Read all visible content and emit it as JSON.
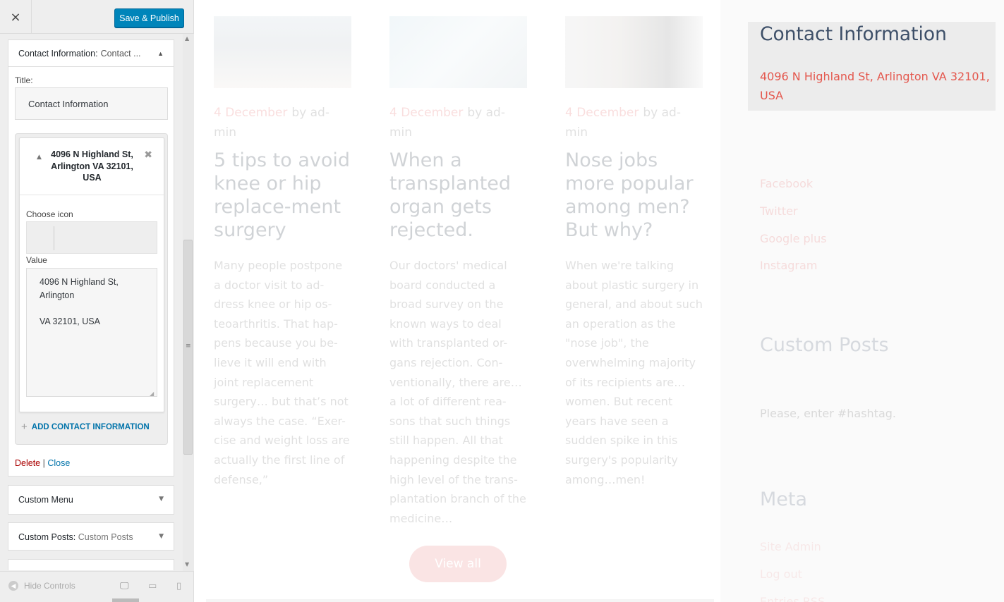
{
  "topbar": {
    "close_icon": "×",
    "publish_label": "Save & Publish"
  },
  "sections": {
    "contact": {
      "title": "Contact Information:",
      "subtitle": "Contact ...",
      "title_label": "Title:",
      "title_value": "Contact Information",
      "item": {
        "title": "4096 N Highland St, Arlington VA 32101, USA",
        "choose_icon_label": "Choose icon",
        "value_label": "Value",
        "value_text": "4096 N Highland St,\nArlington\n\nVA 32101, USA"
      },
      "add_label": "ADD CONTACT INFORMATION",
      "delete_label": "Delete",
      "separator": "|",
      "close_label": "Close"
    },
    "custom_menu": {
      "title": "Custom Menu"
    },
    "custom_posts": {
      "title": "Custom Posts:",
      "subtitle": "Custom Posts"
    }
  },
  "footer": {
    "hide_controls_label": "Hide Controls"
  },
  "preview": {
    "posts": [
      {
        "date": "4 December",
        "byline": "by ad-\nmin",
        "title": "5 tips to avoid knee or hip replace-ment surgery",
        "excerpt": "Many people postpone a doctor visit to ad-dress knee or hip os-teoarthritis. That hap-pens because you be-lieve it will end with joint replacement surgery… but that’s not always the case. “Exer-cise and weight loss are actually the first line of defense,”"
      },
      {
        "date": "4 December",
        "byline": "by ad-\nmin",
        "title": "When a transplanted organ gets rejected.",
        "excerpt": "Our doctors' medical board conducted a broad survey on the known ways to deal with transplanted or-gans rejection. Con-ventionally, there are… a lot of different rea-sons that such things still happen. All that happening despite the high level of the trans-plantation branch of the medicine…"
      },
      {
        "date": "4 December",
        "byline": "by ad-\nmin",
        "title": "Nose jobs more popular among men? But why?",
        "excerpt": "When we're talking about plastic surgery in general, and about such an operation as the \"nose job\", the overwhelming majority of its recipients are… women. But recent years have seen a sudden spike in this surgery's popularity among…men!"
      }
    ],
    "view_all": "View all",
    "widgets": {
      "contact_title": "Contact Information",
      "contact_address": "4096 N Highland St, Arlington VA 32101, USA",
      "social": [
        "Facebook",
        "Twitter",
        "Google plus",
        "Instagram"
      ],
      "custom_posts_title": "Custom Posts",
      "hashtag_prompt": "Please, enter #hashtag.",
      "meta_title": "Meta",
      "meta_links": [
        "Site Admin",
        "Log out",
        "Entries RSS"
      ]
    }
  }
}
